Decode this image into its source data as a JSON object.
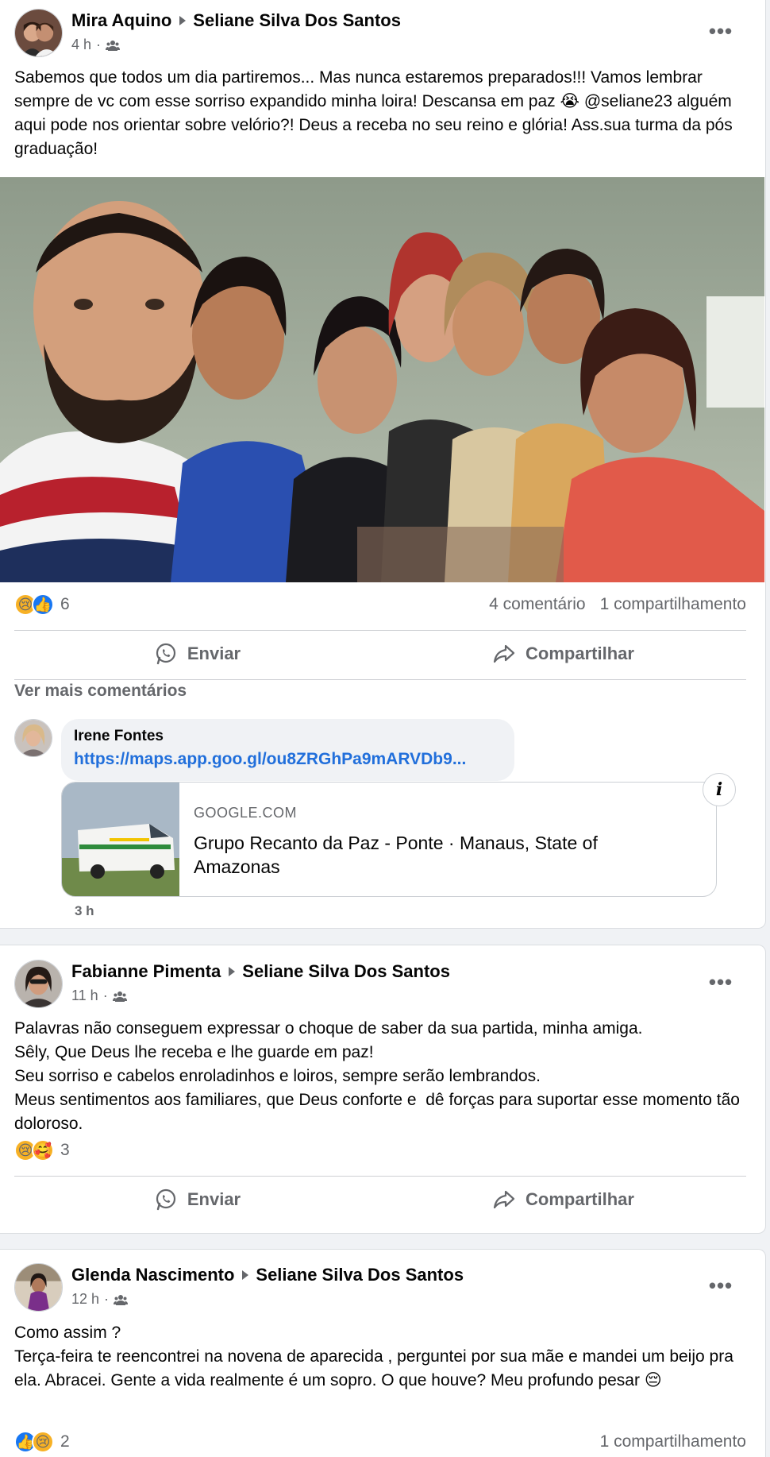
{
  "posts": [
    {
      "author": "Mira Aquino",
      "target": "Seliane Silva Dos Santos",
      "time": "4 h",
      "text": "Sabemos que todos um dia partiremos... Mas nunca estaremos preparados!!! Vamos lembrar sempre de vc com esse sorriso expandido minha loira! Descansa em paz 😭 @seliane23 alguém aqui pode nos orientar sobre velório?! Deus a receba no seu reino e glória! Ass.sua turma da pós graduação!",
      "reaction_count": "6",
      "comments_count": "4 comentário",
      "shares_count": "1 compartilhamento",
      "send_label": "Enviar",
      "share_label": "Compartilhar",
      "more_comments": "Ver mais comentários",
      "comment": {
        "author": "Irene Fontes",
        "link": "https://maps.app.goo.gl/ou8ZRGhPa9mARVDb9...",
        "card_domain": "GOOGLE.COM",
        "card_title": "Grupo Recanto da Paz - Ponte · Manaus, State of Amazonas",
        "time": "3 h"
      }
    },
    {
      "author": "Fabianne Pimenta",
      "target": "Seliane Silva Dos Santos",
      "time": "11 h",
      "text": "Palavras não conseguem expressar o choque de saber da sua partida, minha amiga.\nSêly, Que Deus lhe receba e lhe guarde em paz!\nSeu sorriso e cabelos enroladinhos e loiros, sempre serão lembrandos.\nMeus sentimentos aos familiares, que Deus conforte e  dê forças para suportar esse momento tão doloroso.",
      "reaction_count": "3",
      "send_label": "Enviar",
      "share_label": "Compartilhar"
    },
    {
      "author": "Glenda Nascimento",
      "target": "Seliane Silva Dos Santos",
      "time": "12 h",
      "text": "Como assim ?\nTerça-feira te reencontrei na novena de aparecida , perguntei por sua mãe e mandei um beijo pra ela. Abracei. Gente a vida realmente é um sopro. O que houve? Meu profundo pesar 😔",
      "reaction_count": "2",
      "shares_count": "1 compartilhamento"
    }
  ],
  "ui": {
    "more_icon": "•••",
    "info_icon": "i",
    "separator": "·"
  },
  "colors": {
    "like": "#1877f2",
    "sad": "#f7b125",
    "link": "#216fdb",
    "secondary_text": "#65676b"
  },
  "icons": [
    "group-privacy-icon",
    "whatsapp-icon",
    "share-arrow-icon",
    "sad-reaction-icon",
    "like-reaction-icon",
    "care-reaction-icon",
    "more-options-icon",
    "info-icon"
  ]
}
